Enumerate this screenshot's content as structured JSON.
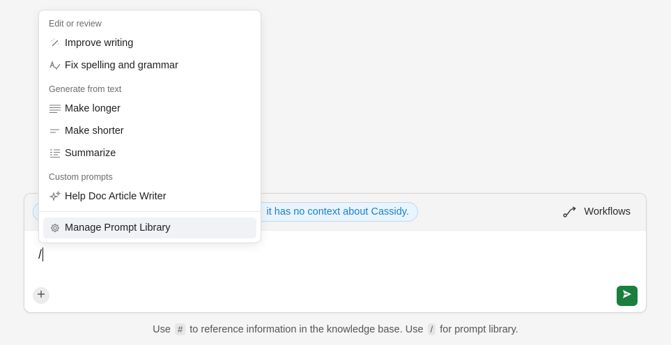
{
  "composer": {
    "context_notice": "it has no context about Cassidy.",
    "workflows_label": "Workflows",
    "input_value": "/"
  },
  "hint": {
    "prefix": "Use",
    "key1": "#",
    "middle": "to reference information in the knowledge base. Use",
    "key2": "/",
    "suffix": "for prompt library."
  },
  "menu": {
    "sections": [
      {
        "title": "Edit or review",
        "items": [
          {
            "label": "Improve writing",
            "icon": "magic-wand-icon"
          },
          {
            "label": "Fix spelling and grammar",
            "icon": "spellcheck-icon"
          }
        ]
      },
      {
        "title": "Generate from text",
        "items": [
          {
            "label": "Make longer",
            "icon": "lines-long-icon"
          },
          {
            "label": "Make shorter",
            "icon": "lines-short-icon"
          },
          {
            "label": "Summarize",
            "icon": "summarize-icon"
          }
        ]
      },
      {
        "title": "Custom prompts",
        "items": [
          {
            "label": "Help Doc Article Writer",
            "icon": "sparkles-icon"
          }
        ]
      }
    ],
    "footer_item": {
      "label": "Manage Prompt Library",
      "icon": "gear-icon"
    }
  },
  "colors": {
    "accent_green": "#1a7f3c",
    "link_blue": "#1b7fd1",
    "pill_bg": "#e9f4fd"
  }
}
